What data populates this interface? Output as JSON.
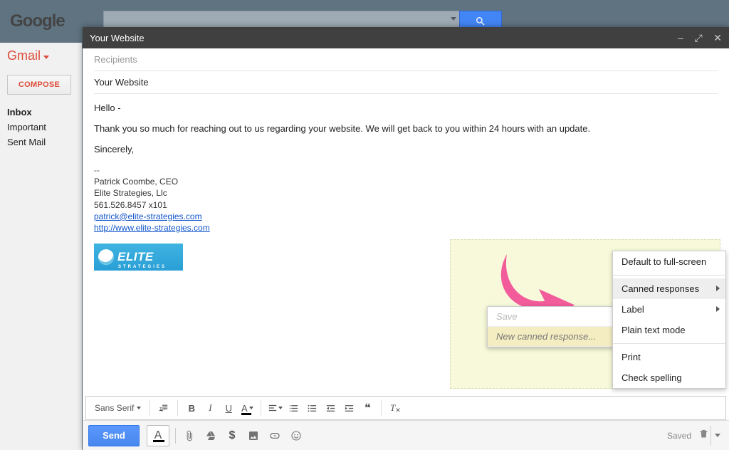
{
  "brand": {
    "google": "Google",
    "gmail": "Gmail"
  },
  "search": {
    "placeholder": ""
  },
  "sidebar": {
    "compose": "COMPOSE",
    "items": [
      {
        "label": "Inbox",
        "active": true
      },
      {
        "label": "Important",
        "active": false
      },
      {
        "label": "Sent Mail",
        "active": false
      }
    ]
  },
  "compose": {
    "title": "Your Website",
    "recipients_placeholder": "Recipients",
    "subject": "Your Website",
    "body": {
      "greeting": "Hello -",
      "line1": "Thank you so much for reaching out to us regarding your website. We will get back to you within 24 hours with an update.",
      "signoff": "Sincerely,"
    },
    "signature": {
      "divider": "--",
      "name": "Patrick Coombe, CEO",
      "company": "Elite Strategies, Llc",
      "phone": "561.526.8457 x101",
      "email": "patrick@elite-strategies.com",
      "url": "http://www.elite-strategies.com"
    },
    "logo": {
      "text": "ELITE",
      "sub": "STRATEGIES"
    }
  },
  "submenu": {
    "save": "Save",
    "new_canned": "New canned response..."
  },
  "more_menu": {
    "fullscreen": "Default to full-screen",
    "canned": "Canned responses",
    "label": "Label",
    "plain": "Plain text mode",
    "print": "Print",
    "spell": "Check spelling"
  },
  "fmt": {
    "font": "Sans Serif"
  },
  "actions": {
    "send": "Send",
    "saved": "Saved"
  }
}
